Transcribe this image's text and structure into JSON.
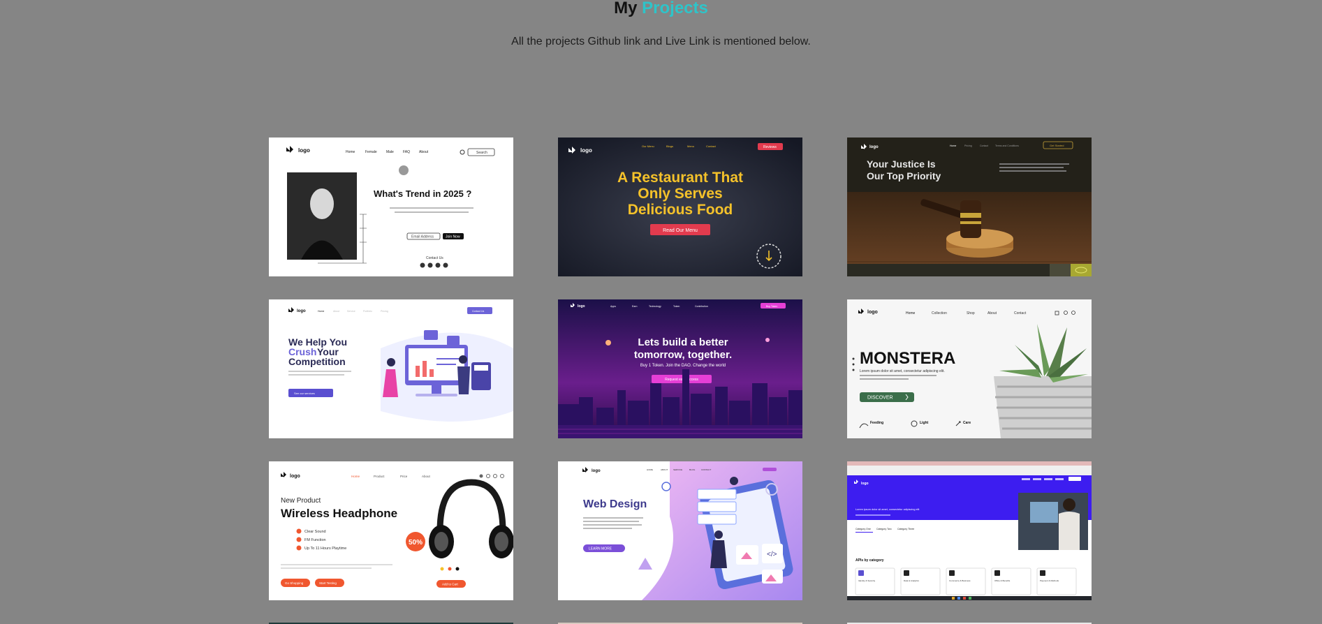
{
  "heading": {
    "prefix": "My",
    "accent": "Projects",
    "accent_color": "#2ec4c9"
  },
  "subtitle": "All the projects Github link and Live Link is mentioned below.",
  "projects": [
    {
      "logo": "logo",
      "nav": [
        "Home",
        "Female",
        "Male",
        "FAQ",
        "About"
      ],
      "search": "Search",
      "headline": "What's Trend in 2025 ?",
      "email_placeholder": "Email Address",
      "cta": "Join Now",
      "contact": "Contact Us"
    },
    {
      "logo": "logo",
      "nav": [
        "Our Menu",
        "Blogs",
        "Menu",
        "Contact"
      ],
      "button": "Reviews",
      "headline": [
        "A Restaurant That",
        "Only Serves",
        "Delicious Food"
      ],
      "cta": "Read Our Menu",
      "accent": "#f5c22a"
    },
    {
      "logo": "logo",
      "nav": [
        "Home",
        "Pricing",
        "Contact",
        "Terms and Conditions"
      ],
      "button": "Get Started",
      "headline": [
        "Your Justice Is",
        "Our Top Priority"
      ]
    },
    {
      "logo": "logo",
      "nav": [
        "Home",
        "About",
        "Service",
        "Portfolio",
        "Pricing"
      ],
      "button": "Contact Us",
      "headline": [
        "We Help You",
        "Crush",
        "Your",
        "Competition"
      ],
      "cta": "See our services",
      "accent": "#6c63d8"
    },
    {
      "logo": "logo",
      "nav": [
        "Apps",
        "Earn",
        "Technology",
        "Token",
        "Contribution"
      ],
      "button": "Buy Token",
      "headline": [
        "Lets build a better",
        "tomorrow, together."
      ],
      "sub": "Buy 1 Token. Join the DAO. Change the world",
      "cta": "Request early access",
      "accent": "#e53fd6"
    },
    {
      "logo": "logo",
      "nav": [
        "Home",
        "Collection",
        "Shop",
        "About",
        "Contact"
      ],
      "headline": "MONSTERA",
      "body": "Lorem ipsum dolor sit amet, consectetur adipiscing elit.",
      "cta": "DISCOVER",
      "features": [
        "Feeding",
        "Light",
        "Care"
      ],
      "accent": "#3b6e4a"
    },
    {
      "logo": "logo",
      "nav": [
        "Home",
        "Product",
        "Price",
        "About"
      ],
      "eyebrow": "New Product",
      "headline": "Wireless Headphone",
      "features": [
        "Clear Sound",
        "FM Function",
        "Up To 11 Hours Playtime"
      ],
      "badge": "50%",
      "cta1": "Go Shopping",
      "cta2": "Start Testing",
      "cta3": "Add to Cart",
      "accent": "#f0572f"
    },
    {
      "logo": "logo",
      "nav": [
        "HOME",
        "ABOUT",
        "SERVICE",
        "BLOG",
        "CONTACT"
      ],
      "headline": "Web Design",
      "cta": "LEARN MORE",
      "accent": "#7b4fd8"
    },
    {
      "logo": "logo",
      "headline": "Lorem ipsum dolor sit amet, consectetur adipiscing elit",
      "section": "APIs by category",
      "tabs": [
        "Category One",
        "Category Two",
        "Category Three"
      ],
      "categories": [
        "Identity & Security",
        "Data & Analytics",
        "Commerce & Business",
        "Office & Benefits",
        "Payment & Methods"
      ],
      "accent": "#3d1df0"
    }
  ]
}
